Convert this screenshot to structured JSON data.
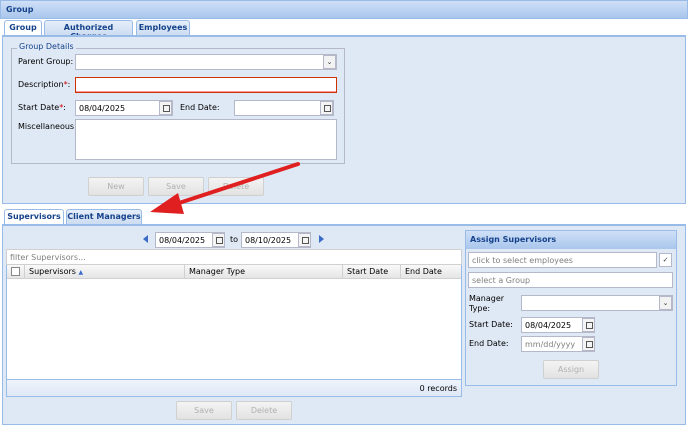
{
  "window": {
    "title": "Group"
  },
  "top_tabs": [
    "Group",
    "Authorized Charges",
    "Employees"
  ],
  "group_details": {
    "legend": "Group Details",
    "parent_group_label": "Parent Group:",
    "description_label": "Description",
    "required_mark": "*",
    "colon": ":",
    "start_date_label": "Start Date",
    "start_date_value": "08/04/2025",
    "end_date_label": "End Date:",
    "end_date_value": "",
    "misc_label": "Miscellaneous:"
  },
  "group_buttons": {
    "new": "New",
    "save": "Save",
    "delete": "Delete"
  },
  "sub_tabs": [
    "Supervisors",
    "Client Managers"
  ],
  "date_range": {
    "from": "08/04/2025",
    "to_label": "to",
    "to": "08/10/2025"
  },
  "filter": {
    "placeholder": "filter Supervisors..."
  },
  "grid": {
    "columns": [
      "Supervisors",
      "Manager Type",
      "Start Date",
      "End Date"
    ],
    "sort_indicator": "▲",
    "footer": "0 records"
  },
  "grid_buttons": {
    "save": "Save",
    "delete": "Delete"
  },
  "assign": {
    "title": "Assign Supervisors",
    "employees_placeholder": "click to select employees",
    "group_placeholder": "select a Group",
    "manager_type_label_1": "Manager",
    "manager_type_label_2": "Type:",
    "start_date_label": "Start Date:",
    "start_date_value": "08/04/2025",
    "end_date_label": "End Date:",
    "end_date_placeholder": "mm/dd/yyyy",
    "assign_button": "Assign"
  },
  "colors": {
    "accent": "#15428b",
    "panel": "#dfe9f5",
    "border": "#99bbe8",
    "annotation": "#e02020"
  },
  "icons": {
    "dropdown": "chevron-down-icon",
    "calendar": "calendar-icon",
    "prev": "left-arrow-icon",
    "next": "right-arrow-icon",
    "check": "checkmark-icon",
    "annotation": "red-arrow-icon"
  }
}
